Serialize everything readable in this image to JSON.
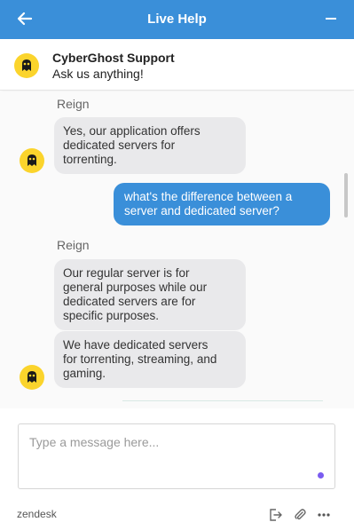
{
  "header": {
    "title": "Live Help",
    "back_icon": "arrow-left-icon",
    "minimize_icon": "minus-icon",
    "color": "#3a8fd9"
  },
  "agent": {
    "name": "CyberGhost Support",
    "subtitle": "Ask us anything!",
    "avatar_icon": "cyberghost-logo-icon",
    "avatar_color": "#fbd42c"
  },
  "messages": [
    {
      "type": "sender",
      "text": "Reign"
    },
    {
      "type": "in",
      "lines": [
        "Yes, our application offers",
        "dedicated servers for",
        "torrenting."
      ]
    },
    {
      "type": "out",
      "lines": [
        "what's the difference between a",
        "server and dedicated server?"
      ]
    },
    {
      "type": "sender",
      "text": "Reign"
    },
    {
      "type": "in",
      "lines": [
        "Our regular server is for",
        "general purposes while our",
        "dedicated servers are for",
        "specific purposes."
      ]
    },
    {
      "type": "in",
      "lines": [
        "We have dedicated servers",
        "for torrenting, streaming, and",
        "gaming."
      ]
    }
  ],
  "composer": {
    "placeholder": "Type a message here...",
    "value": ""
  },
  "footer": {
    "brand": "zendesk",
    "icons": [
      "end-chat-icon",
      "paperclip-icon",
      "more-options-icon"
    ]
  }
}
